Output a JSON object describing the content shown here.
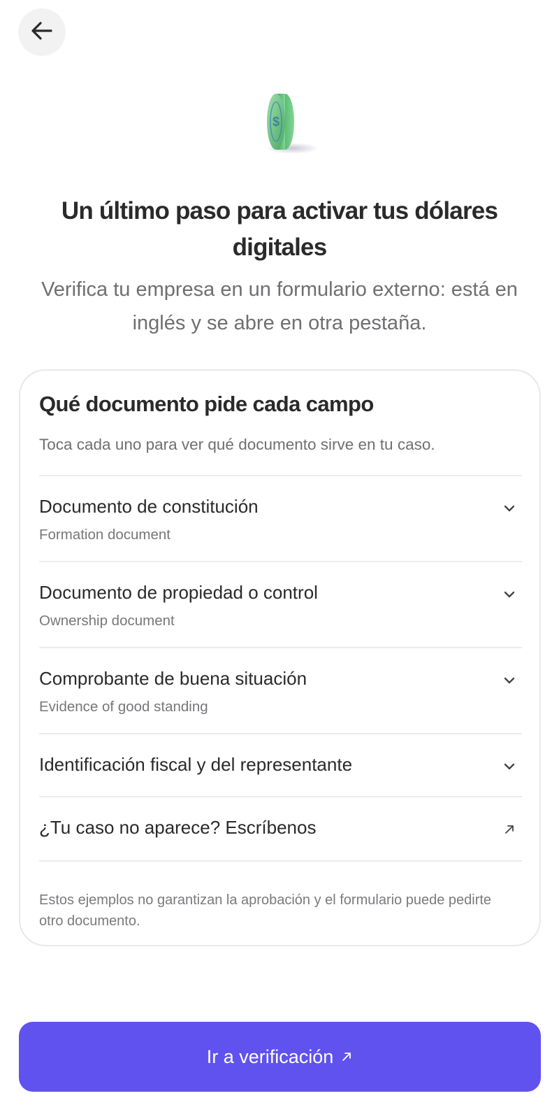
{
  "header": {
    "back_icon": "arrow-left-icon"
  },
  "hero": {
    "image": "green-coin-illustration"
  },
  "intro": {
    "title": "Un último paso para activar tus dólares digitales",
    "subtitle": "Verifica tu empresa en un formulario externo: está en inglés y se abre en otra pestaña."
  },
  "card": {
    "title": "Qué documento pide cada campo",
    "description": "Toca cada uno para ver qué documento sirve en tu caso.",
    "items": [
      {
        "title": "Documento de constitución",
        "subtitle": "Formation document",
        "icon": "chevron-down-icon"
      },
      {
        "title": "Documento de propiedad o control",
        "subtitle": "Ownership document",
        "icon": "chevron-down-icon"
      },
      {
        "title": "Comprobante de buena situación",
        "subtitle": "Evidence of good standing",
        "icon": "chevron-down-icon"
      },
      {
        "title": "Identificación fiscal y del representante",
        "icon": "chevron-down-icon"
      }
    ],
    "contact": {
      "label": "¿Tu caso no aparece? Escríbenos",
      "icon": "external-arrow-icon"
    },
    "disclaimer": "Estos ejemplos no garantizan la aprobación y el formulario puede pedirte otro documento."
  },
  "cta": {
    "label": "Ir a verificación",
    "icon": "external-arrow-icon"
  },
  "colors": {
    "accent": "#6052ef",
    "coin_green": "#5cbf73",
    "text_primary": "#2a2a2a",
    "text_secondary": "#6f6f73",
    "divider": "#ececee"
  }
}
